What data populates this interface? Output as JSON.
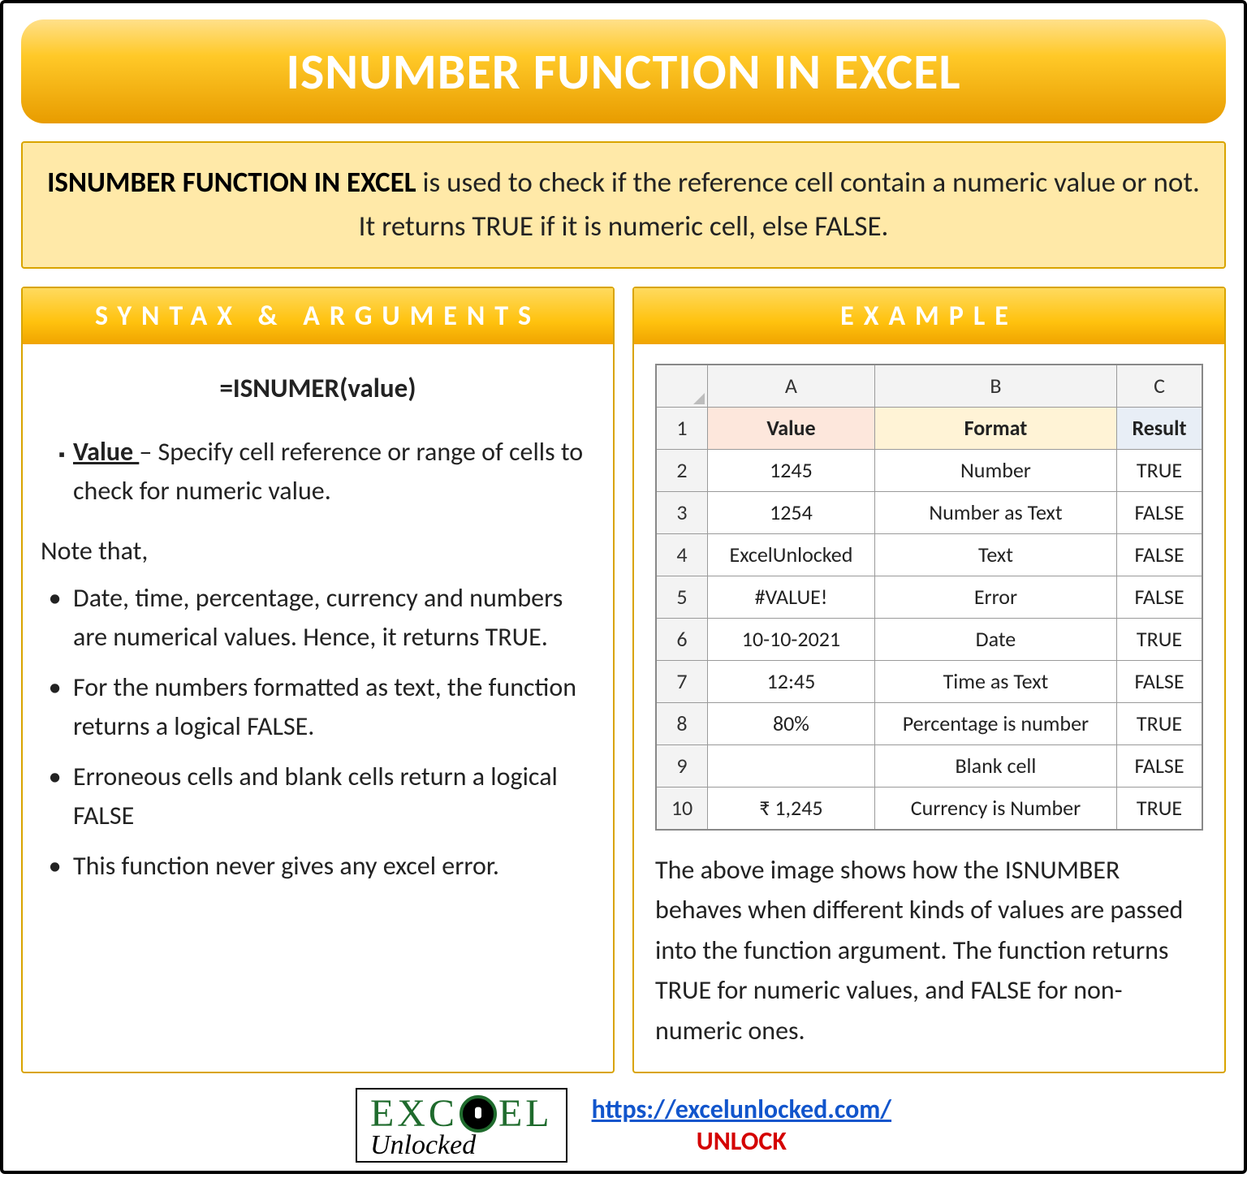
{
  "title": "ISNUMBER FUNCTION IN EXCEL",
  "description": {
    "lead": "ISNUMBER FUNCTION IN EXCEL",
    "rest": " is used to check if the reference cell contain a numeric value or not. It returns TRUE if it is numeric cell, else FALSE."
  },
  "syntax": {
    "header": "SYNTAX & ARGUMENTS",
    "formula": "=ISNUMER(value)",
    "arg_name": "Value ",
    "arg_desc": "– Specify cell reference or range of cells to check for numeric value.",
    "note_head": "Note that,",
    "notes": [
      "Date, time, percentage, currency and numbers are numerical values. Hence, it returns TRUE.",
      "For the numbers formatted as text, the function returns a logical FALSE.",
      "Erroneous cells and blank cells return a logical FALSE",
      "This function never gives any excel error."
    ]
  },
  "example": {
    "header": "EXAMPLE",
    "col_letters": [
      "A",
      "B",
      "C"
    ],
    "head_row": {
      "num": "1",
      "a": "Value",
      "b": "Format",
      "c": "Result"
    },
    "rows": [
      {
        "num": "2",
        "a": "1245",
        "b": "Number",
        "c": "TRUE"
      },
      {
        "num": "3",
        "a": "1254",
        "b": "Number as Text",
        "c": "FALSE"
      },
      {
        "num": "4",
        "a": "ExcelUnlocked",
        "b": "Text",
        "c": "FALSE"
      },
      {
        "num": "5",
        "a": "#VALUE!",
        "b": "Error",
        "c": "FALSE"
      },
      {
        "num": "6",
        "a": "10-10-2021",
        "b": "Date",
        "c": "TRUE"
      },
      {
        "num": "7",
        "a": "12:45",
        "b": "Time as Text",
        "c": "FALSE"
      },
      {
        "num": "8",
        "a": "80%",
        "b": "Percentage is number",
        "c": "TRUE"
      },
      {
        "num": "9",
        "a": "",
        "b": "Blank cell",
        "c": "FALSE"
      },
      {
        "num": "10",
        "a": "₹ 1,245",
        "b": "Currency is Number",
        "c": "TRUE"
      }
    ],
    "caption": "The above image shows how the ISNUMBER behaves when different kinds of values are passed into the function argument. The function returns TRUE for numeric values, and FALSE for non-numeric ones."
  },
  "footer": {
    "logo_top_left": "EXC",
    "logo_top_right": "EL",
    "logo_bottom": "Unlocked",
    "url": "https://excelunlocked.com/",
    "unlock": "UNLOCK"
  }
}
